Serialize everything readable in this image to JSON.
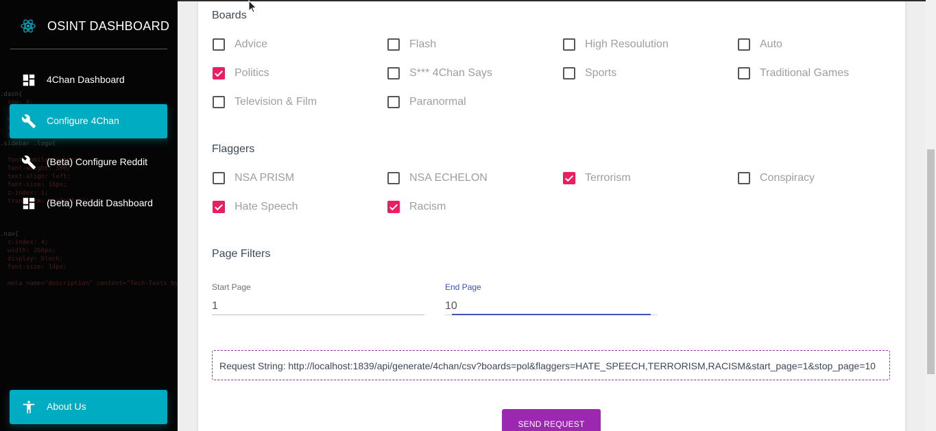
{
  "app": {
    "title": "OSINT DASHBOARD",
    "accent_color": "#00acc1",
    "checkbox_color": "#e91e63",
    "button_color": "#9c27b0",
    "logo_icon": "atom-icon"
  },
  "sidebar": {
    "items": [
      {
        "label": "4Chan Dashboard",
        "icon": "dashboard-icon",
        "active": false
      },
      {
        "label": "Configure 4Chan",
        "icon": "wrench-icon",
        "active": true
      },
      {
        "label": "(Beta) Configure Reddit",
        "icon": "wrench-icon",
        "active": false
      },
      {
        "label": "(Beta) Reddit Dashboard",
        "icon": "dashboard-icon",
        "active": false
      }
    ],
    "bottom_item": {
      "label": "About Us",
      "icon": "accessibility-icon"
    }
  },
  "boards": {
    "title": "Boards",
    "items": [
      {
        "label": "Advice",
        "checked": false
      },
      {
        "label": "Flash",
        "checked": false
      },
      {
        "label": "High Resoulution",
        "checked": false
      },
      {
        "label": "Auto",
        "checked": false
      },
      {
        "label": "Politics",
        "checked": true
      },
      {
        "label": "S*** 4Chan Says",
        "checked": false
      },
      {
        "label": "Sports",
        "checked": false
      },
      {
        "label": "Traditional Games",
        "checked": false
      },
      {
        "label": "Television & Film",
        "checked": false
      },
      {
        "label": "Paranormal",
        "checked": false
      }
    ]
  },
  "flaggers": {
    "title": "Flaggers",
    "items": [
      {
        "label": "NSA PRISM",
        "checked": false
      },
      {
        "label": "NSA ECHELON",
        "checked": false
      },
      {
        "label": "Terrorism",
        "checked": true
      },
      {
        "label": "Conspiracy",
        "checked": false
      },
      {
        "label": "Hate Speech",
        "checked": true
      },
      {
        "label": "Racism",
        "checked": true
      }
    ]
  },
  "page_filters": {
    "title": "Page Filters",
    "start_label": "Start Page",
    "start_value": "1",
    "end_label": "End Page",
    "end_value": "10"
  },
  "request": {
    "text": "Request String: http://localhost:1839/api/generate/4chan/csv?boards=pol&flaggers=HATE_SPEECH,TERRORISM,RACISM&start_page=1&stop_page=10",
    "button_label": "SEND REQUEST"
  }
}
